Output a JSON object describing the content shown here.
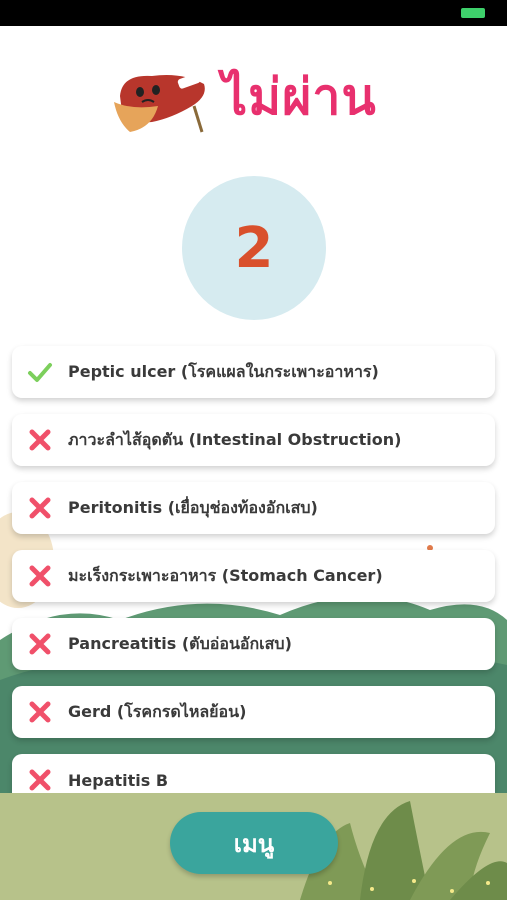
{
  "header": {
    "title": "ไม่ผ่าน"
  },
  "score": {
    "value": "2"
  },
  "results": [
    {
      "label": "Peptic ulcer (โรคแผลในกระเพาะอาหาร)",
      "status": "correct",
      "icon": "check-icon"
    },
    {
      "label": "ภาวะลำไส้อุดตัน (Intestinal Obstruction)",
      "status": "wrong",
      "icon": "cross-icon"
    },
    {
      "label": "Peritonitis (เยื่อบุช่องท้องอักเสบ)",
      "status": "wrong",
      "icon": "cross-icon"
    },
    {
      "label": "มะเร็งกระเพาะอาหาร (Stomach Cancer)",
      "status": "wrong",
      "icon": "cross-icon"
    },
    {
      "label": "Pancreatitis (ตับอ่อนอักเสบ)",
      "status": "wrong",
      "icon": "cross-icon"
    },
    {
      "label": "Gerd (โรคกรดไหลย้อน)",
      "status": "wrong",
      "icon": "cross-icon"
    },
    {
      "label": "Hepatitis B",
      "status": "wrong",
      "icon": "cross-icon"
    }
  ],
  "menu": {
    "label": "เมนู"
  },
  "colors": {
    "title": "#e8306e",
    "score": "#d9502c",
    "score_circle": "#d6ebf0",
    "correct": "#7ccf5c",
    "wrong": "#f0506a",
    "menu_button": "#3aa59d"
  }
}
